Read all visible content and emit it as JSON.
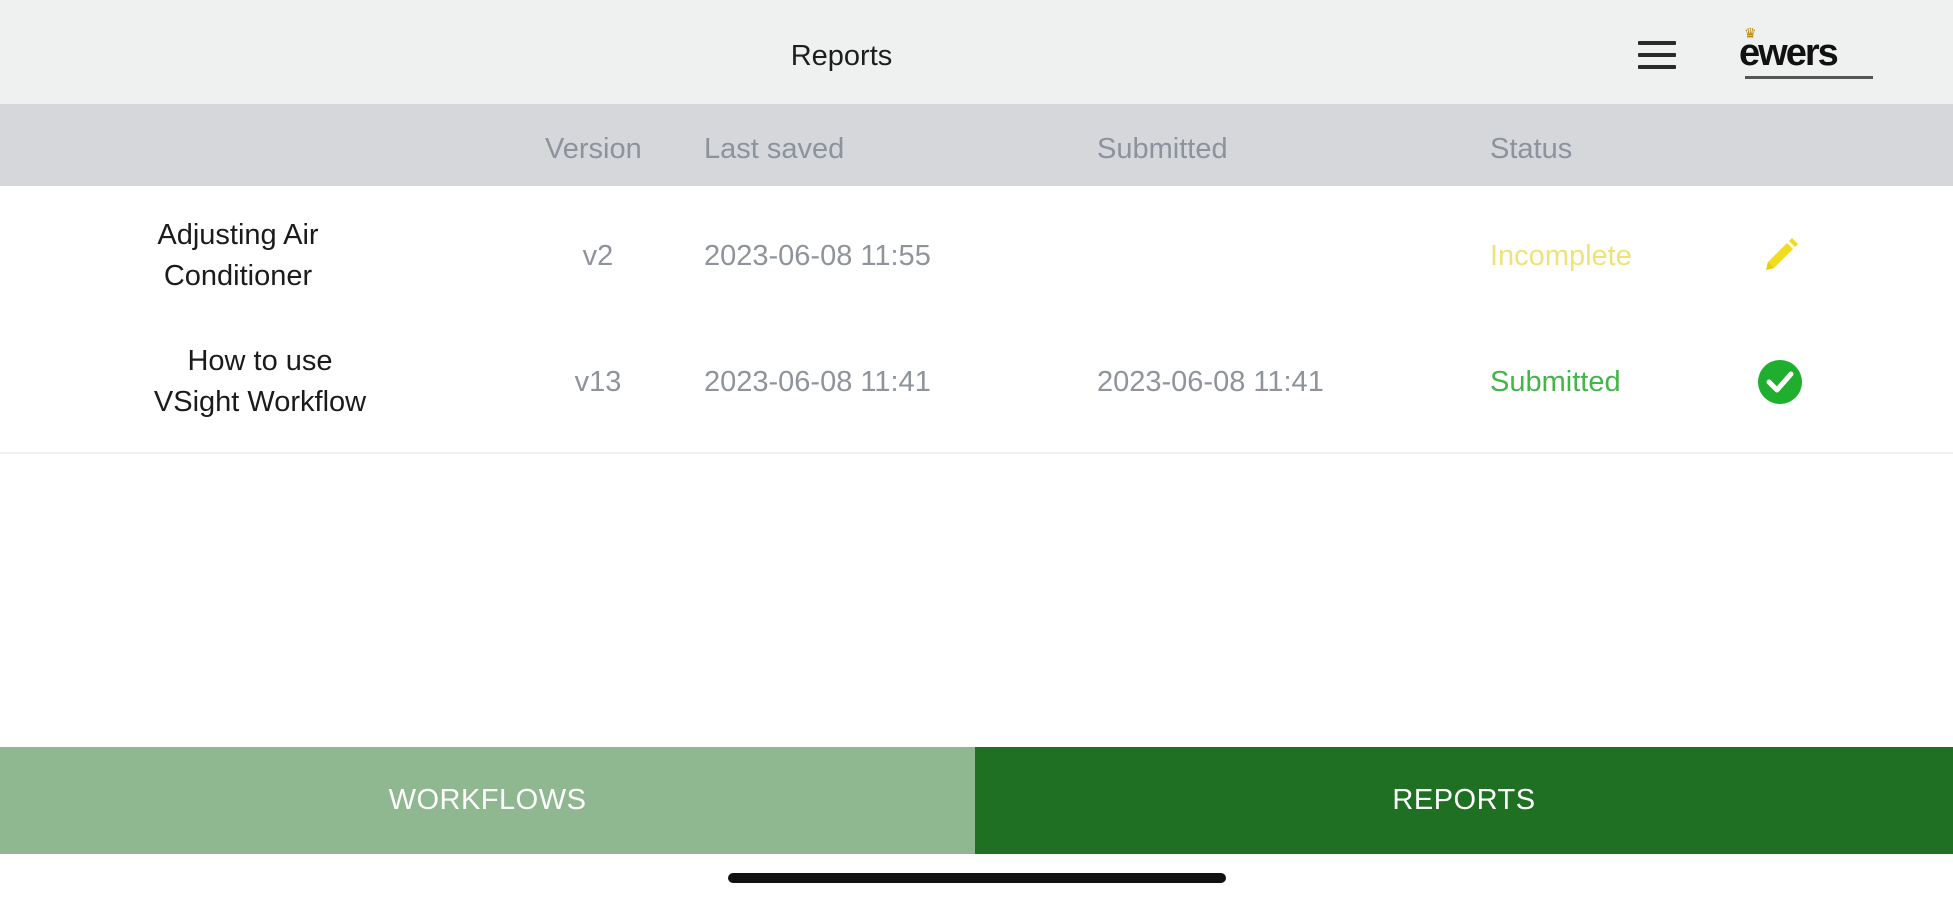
{
  "header": {
    "title": "Reports",
    "menu_icon": "hamburger-menu-icon",
    "logo_text": "ewers"
  },
  "table": {
    "columns": {
      "version": "Version",
      "last_saved": "Last saved",
      "submitted": "Submitted",
      "status": "Status"
    },
    "rows": [
      {
        "name_line1": "Adjusting Air",
        "name_line2": "Conditioner",
        "version": "v2",
        "last_saved": "2023-06-08 11:55",
        "submitted": "",
        "status": "Incomplete",
        "status_color": "#f0e27a",
        "action_icon": "pencil-edit-icon"
      },
      {
        "name_line1": "How to use",
        "name_line2": "VSight Workflow",
        "version": "v13",
        "last_saved": "2023-06-08 11:41",
        "submitted": "2023-06-08 11:41",
        "status": "Submitted",
        "status_color": "#43b54a",
        "action_icon": "check-circle-icon"
      }
    ]
  },
  "tabs": {
    "workflows": "WORKFLOWS",
    "reports": "REPORTS",
    "active": "reports",
    "active_color": "#207024",
    "inactive_color": "#8fb890"
  }
}
